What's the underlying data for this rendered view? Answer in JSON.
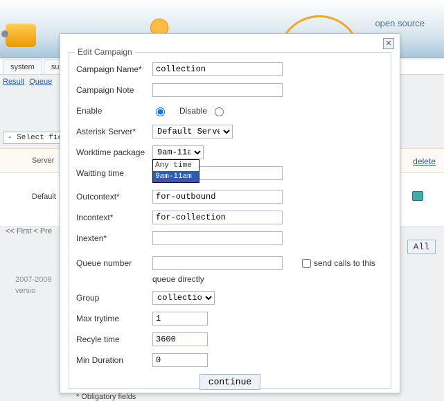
{
  "branding": {
    "open_source": "open source"
  },
  "tabs": {
    "system": "system",
    "su": "su"
  },
  "crumbs": {
    "result": "Result",
    "queue": "Queue"
  },
  "bg": {
    "select_field": "- Select field",
    "server_col": "Server",
    "default_val": "Default",
    "delete": "delete",
    "pager": "<< First < Pre",
    "all": "All",
    "year": "2007-2009",
    "version": "versio"
  },
  "dialog": {
    "title": "Edit Campaign",
    "close_glyph": "✕",
    "labels": {
      "name": "Campaign Name*",
      "note": "Campaign Note",
      "enable": "Enable",
      "disable": "Disable",
      "asterisk": "Asterisk Server*",
      "worktime": "Worktime package",
      "waiting": "Waitting time",
      "outcontext": "Outcontext*",
      "incontext": "Incontext*",
      "inexten": "Inexten*",
      "queue": "Queue number",
      "queue_note": "queue directly",
      "send_calls": "send calls to this",
      "group": "Group",
      "maxtry": "Max trytime",
      "recycle": "Recyle time",
      "mindur": "Min Duration",
      "continue": "continue",
      "oblig": "* Obligatory fields"
    },
    "values": {
      "name": "collection",
      "note": "",
      "enable_radio": "enable",
      "asterisk": "Default Server",
      "worktime": "9am-11am",
      "worktime_opts": [
        "Any time",
        "9am-11am"
      ],
      "waiting": "",
      "outcontext": "for-outbound",
      "incontext": "for-collection",
      "inexten": "",
      "queue": "",
      "send_calls_checked": false,
      "group": "collection",
      "maxtry": "1",
      "recycle": "3600",
      "mindur": "0"
    }
  }
}
